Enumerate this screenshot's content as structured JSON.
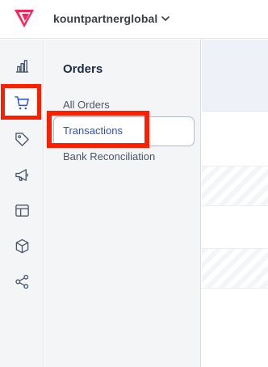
{
  "header": {
    "store_name": "kountpartnerglobal",
    "brand_color": "#ff1f5a"
  },
  "rail": {
    "items": [
      {
        "icon": "bar-chart-icon"
      },
      {
        "icon": "cart-icon",
        "active": true
      },
      {
        "icon": "tag-icon"
      },
      {
        "icon": "megaphone-icon"
      },
      {
        "icon": "layout-icon"
      },
      {
        "icon": "cube-icon"
      },
      {
        "icon": "share-icon"
      }
    ]
  },
  "subnav": {
    "title": "Orders",
    "items": [
      {
        "label": "All Orders"
      },
      {
        "label": "Transactions",
        "active": true
      },
      {
        "label": "Bank Reconciliation"
      }
    ]
  },
  "colors": {
    "accent": "#2a50c8",
    "highlight": "#ff1f00",
    "rail_bg": "#f4f5f7"
  }
}
